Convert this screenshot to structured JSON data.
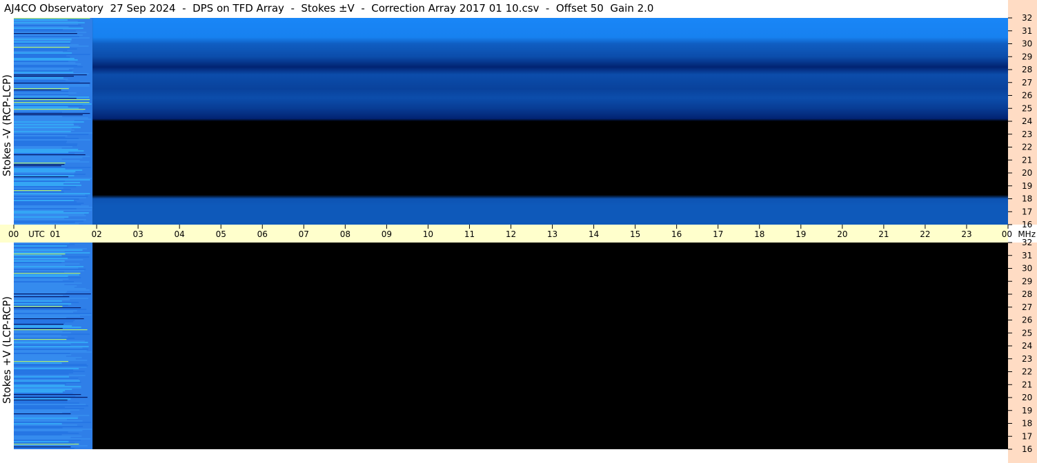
{
  "title": "AJ4CO Observatory  27 Sep 2024  -  DPS on TFD Array  -  Stokes ±V  -  Correction Array 2017 01 10.csv  -  Offset 50  Gain 2.0",
  "panels": [
    {
      "ylabel": "Stokes -V  (RCP-LCP)"
    },
    {
      "ylabel": "Stokes +V  (LCP-RCP)"
    }
  ],
  "colors": {
    "time_axis_bg": "#ffffcc",
    "freq_axis_bg": "#ffdcc4",
    "plot_bg": "#000000",
    "bright_blue": "#1a8cff",
    "mid_blue": "#0a5ae6",
    "dark_blue": "#001a66",
    "noise_cyan": "#39c7ff"
  },
  "chart_data": {
    "type": "heatmap",
    "x": {
      "unit": "UTC",
      "range": [
        0,
        24
      ],
      "tick_labels": [
        "00",
        "01",
        "02",
        "03",
        "04",
        "05",
        "06",
        "07",
        "08",
        "09",
        "10",
        "11",
        "12",
        "13",
        "14",
        "15",
        "16",
        "17",
        "18",
        "19",
        "20",
        "21",
        "22",
        "23",
        "00"
      ],
      "axis_caption": "UTC",
      "end_unit": "MHz"
    },
    "y": {
      "unit": "MHz",
      "range": [
        16,
        32
      ],
      "tick_labels": [
        "32",
        "31",
        "30",
        "29",
        "28",
        "27",
        "26",
        "25",
        "24",
        "23",
        "22",
        "21",
        "20",
        "19",
        "18",
        "17",
        "16"
      ]
    },
    "data_start_hour": 0,
    "data_end_hour": 1.9,
    "upper_fill_profile": [
      {
        "mhz": 32,
        "level": 0.95
      },
      {
        "mhz": 30.5,
        "level": 0.9
      },
      {
        "mhz": 30,
        "level": 0.6
      },
      {
        "mhz": 29,
        "level": 0.45
      },
      {
        "mhz": 28.2,
        "level": 0.08
      },
      {
        "mhz": 27.6,
        "level": 0.45
      },
      {
        "mhz": 26.5,
        "level": 0.35
      },
      {
        "mhz": 25.8,
        "level": 0.45
      },
      {
        "mhz": 25,
        "level": 0.3
      },
      {
        "mhz": 24.2,
        "level": 0.08
      },
      {
        "mhz": 24,
        "level": 0.0
      },
      {
        "mhz": 18.3,
        "level": 0.0
      },
      {
        "mhz": 18,
        "level": 0.5
      },
      {
        "mhz": 17.5,
        "level": 0.55
      },
      {
        "mhz": 16,
        "level": 0.55
      }
    ]
  }
}
